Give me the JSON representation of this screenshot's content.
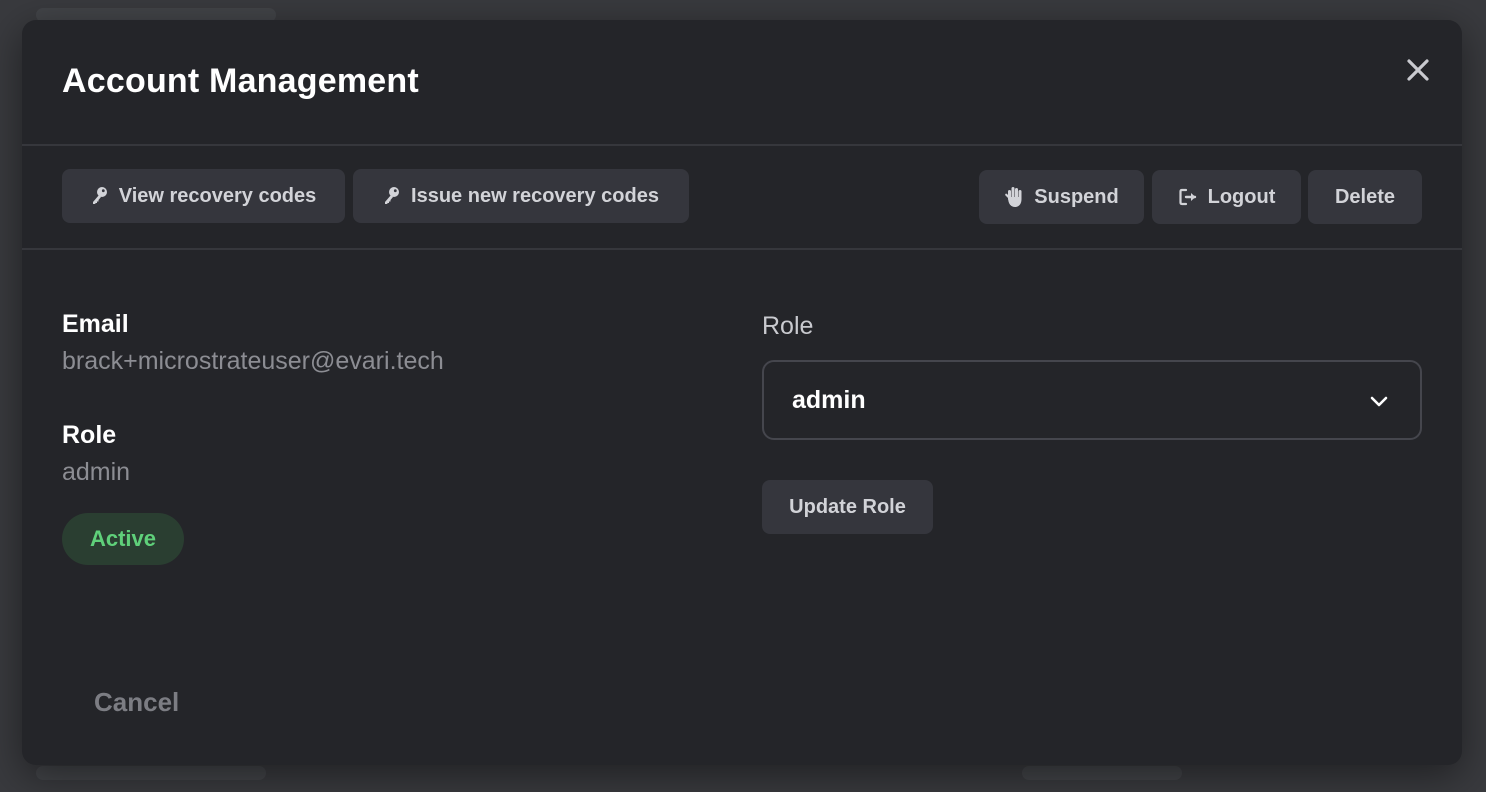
{
  "modal": {
    "title": "Account Management"
  },
  "toolbar": {
    "view_recovery_codes": "View recovery codes",
    "issue_recovery_codes": "Issue new recovery codes",
    "suspend": "Suspend",
    "logout": "Logout",
    "delete": "Delete"
  },
  "account": {
    "email_label": "Email",
    "email_value": "brack+microstrateuser@evari.tech",
    "role_label": "Role",
    "role_value": "admin",
    "status": "Active"
  },
  "role_editor": {
    "label": "Role",
    "selected": "admin",
    "update_button": "Update Role"
  },
  "footer": {
    "cancel": "Cancel"
  },
  "colors": {
    "modal_bg": "#242529",
    "button_bg": "#35363d",
    "status_active_text": "#5fd07a",
    "status_active_bg": "#2a3e31"
  },
  "icons": {
    "close": "close-icon",
    "key": "key-icon",
    "hand": "hand-icon",
    "logout": "logout-icon",
    "chevron": "chevron-down-icon"
  }
}
